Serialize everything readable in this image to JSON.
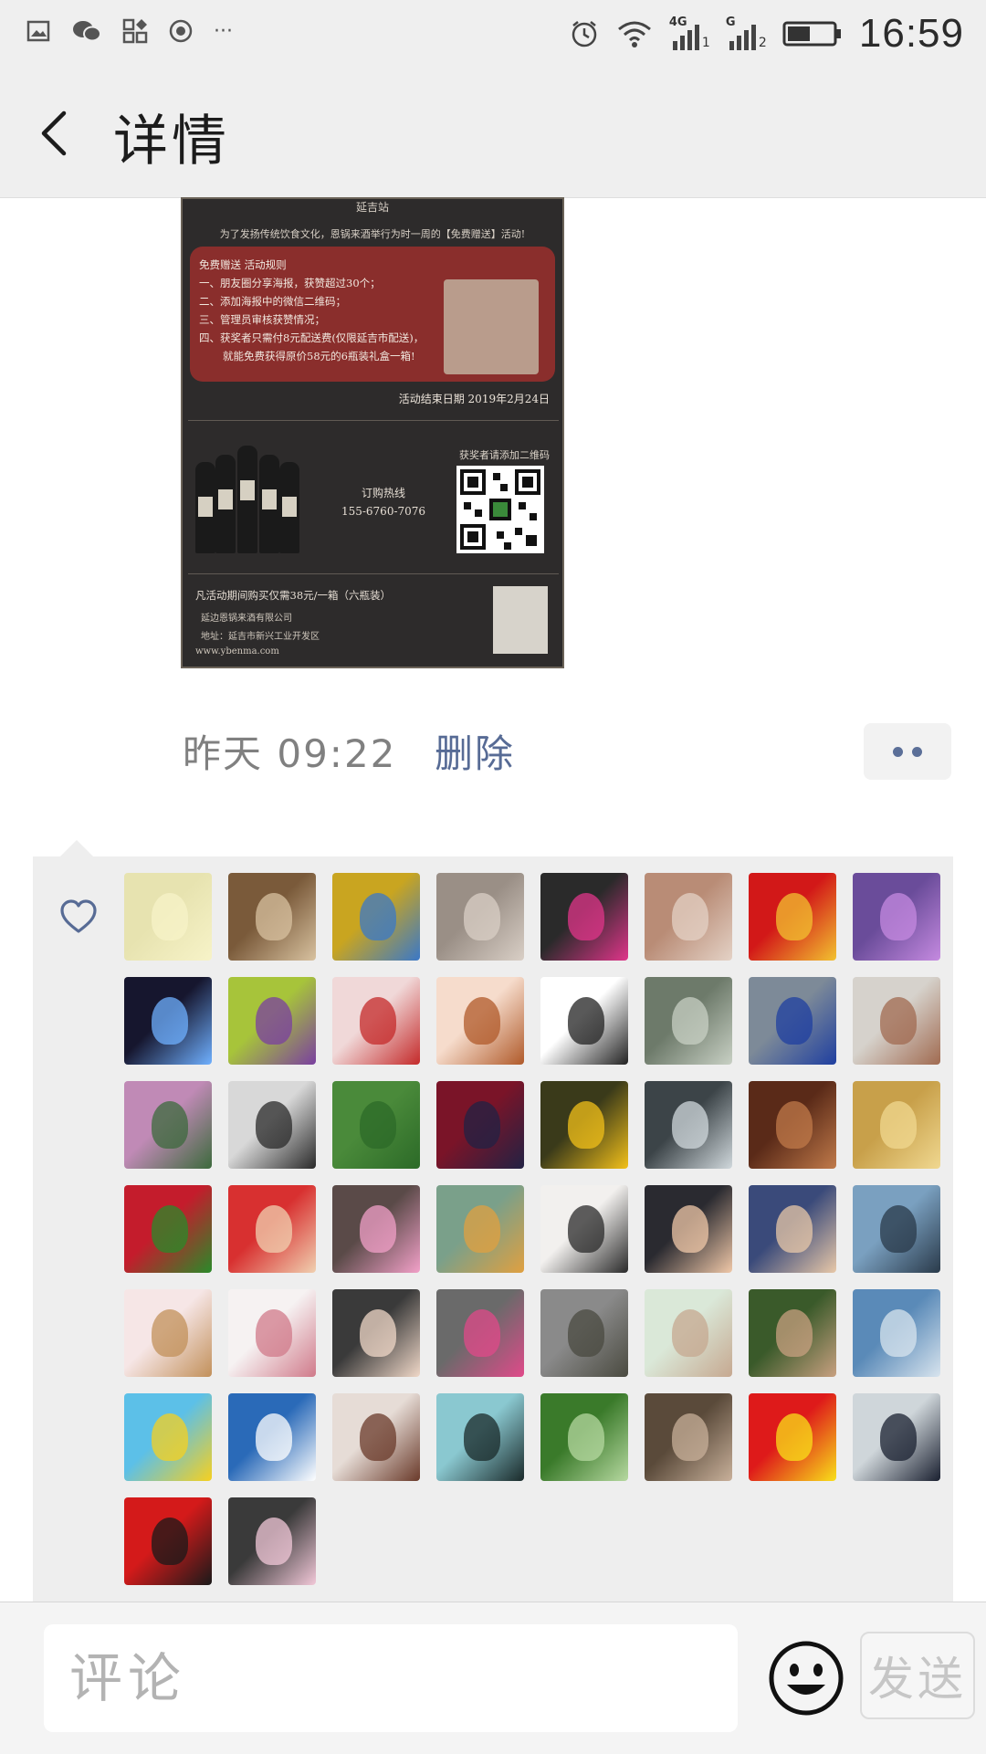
{
  "status_bar": {
    "time": "16:59",
    "network_1": "4G",
    "sim_1": "1",
    "network_2": "G",
    "sim_2": "2",
    "more": "···",
    "icons": [
      "gallery-icon",
      "wechat-icon",
      "apps-icon",
      "record-icon",
      "alarm-icon",
      "wifi-icon",
      "signal-icon",
      "battery-icon"
    ]
  },
  "nav": {
    "title": "详情",
    "back_icon": "chevron-left-icon"
  },
  "poster": {
    "station": "延吉站",
    "intro": "为了发扬传统饮食文化，恩锅来酒举行为时一周的【免费赠送】活动!",
    "rules_title": "免费赠送 活动规则",
    "rules": [
      "一、朋友圈分享海报，获赞超过30个；",
      "二、添加海报中的微信二维码；",
      "三、管理员审核获赞情况；",
      "四、获奖者只需付8元配送费(仅限延吉市配送)，",
      "就能免费获得原价58元的6瓶装礼盒一箱!"
    ],
    "end_date": "活动结束日期 2019年2月24日",
    "hotline_label": "订购热线",
    "hotline_number": "155-6760-7076",
    "qr_label": "获奖者请添加二维码",
    "buy_text": "凡活动期间购买仅需38元/一箱（六瓶装）",
    "company": "延边恩锅来酒有限公司",
    "address": "地址：延吉市新兴工业开发区",
    "website": "www.ybenma.com"
  },
  "post_meta": {
    "time": "昨天 09:22",
    "delete_label": "删除",
    "more_icon": "more-dots-icon"
  },
  "likes": {
    "heart_icon": "heart-outline-icon",
    "avatars": [
      {
        "color": "#e7e3b0",
        "accent": "#f7f3c8"
      },
      {
        "color": "#7a5a3a",
        "accent": "#d8c2a0"
      },
      {
        "color": "#c9a520",
        "accent": "#3a78c8"
      },
      {
        "color": "#9a8f86",
        "accent": "#d9cfc6"
      },
      {
        "color": "#2a2a2a",
        "accent": "#e0358a"
      },
      {
        "color": "#b98c76",
        "accent": "#e4d2c6"
      },
      {
        "color": "#d21818",
        "accent": "#f2c230"
      },
      {
        "color": "#6a4c9a",
        "accent": "#c58ae0"
      },
      {
        "color": "#16162e",
        "accent": "#6fb0ff"
      },
      {
        "color": "#a7c43a",
        "accent": "#7a3fa0"
      },
      {
        "color": "#f0d8d8",
        "accent": "#c42a2a"
      },
      {
        "color": "#f6dccc",
        "accent": "#b05a2a"
      },
      {
        "color": "#ffffff",
        "accent": "#222222"
      },
      {
        "color": "#6d7a6a",
        "accent": "#c8d0c4"
      },
      {
        "color": "#7d8a98",
        "accent": "#1f3fa0"
      },
      {
        "color": "#d6d2cc",
        "accent": "#a06a50"
      },
      {
        "color": "#c08ab6",
        "accent": "#3c6a3c"
      },
      {
        "color": "#d8d8d8",
        "accent": "#2a2a2a"
      },
      {
        "color": "#4a8a3a",
        "accent": "#2c6a28"
      },
      {
        "color": "#7a1428",
        "accent": "#222244"
      },
      {
        "color": "#3a3a1a",
        "accent": "#f2c01a"
      },
      {
        "color": "#3c4448",
        "accent": "#d0d8dc"
      },
      {
        "color": "#5a2a18",
        "accent": "#c07a4a"
      },
      {
        "color": "#c8a04a",
        "accent": "#f0d890"
      },
      {
        "color": "#c41c2c",
        "accent": "#2a8a2a"
      },
      {
        "color": "#d83030",
        "accent": "#f0d0b0"
      },
      {
        "color": "#5a4a48",
        "accent": "#f2a0c8"
      },
      {
        "color": "#7aa08a",
        "accent": "#e0a040"
      },
      {
        "color": "#f2f0ee",
        "accent": "#2a2a2a"
      },
      {
        "color": "#2a2a30",
        "accent": "#f0c8a8"
      },
      {
        "color": "#3a4a7a",
        "accent": "#e8c8a8"
      },
      {
        "color": "#7aa0c0",
        "accent": "#2a3a4a"
      },
      {
        "color": "#f6e6e6",
        "accent": "#c2905a"
      },
      {
        "color": "#f6f2f2",
        "accent": "#d07a8a"
      },
      {
        "color": "#3a3a3a",
        "accent": "#f0d8c8"
      },
      {
        "color": "#6a6a6a",
        "accent": "#e04a8a"
      },
      {
        "color": "#8a8a8a",
        "accent": "#4a4a40"
      },
      {
        "color": "#dae8d8",
        "accent": "#c6a890"
      },
      {
        "color": "#3a5a2a",
        "accent": "#c8a080"
      },
      {
        "color": "#5a8ab8",
        "accent": "#d8e4ee"
      },
      {
        "color": "#5cc0e8",
        "accent": "#f6d020"
      },
      {
        "color": "#2a6ab8",
        "accent": "#ffffff"
      },
      {
        "color": "#e6dcd6",
        "accent": "#6a3a2a"
      },
      {
        "color": "#8ac8d0",
        "accent": "#1a2a2a"
      },
      {
        "color": "#3a7a2a",
        "accent": "#b6d8a0"
      },
      {
        "color": "#5a4a3a",
        "accent": "#c8b09a"
      },
      {
        "color": "#de1a1a",
        "accent": "#f8e01a"
      },
      {
        "color": "#cfd6da",
        "accent": "#1a2030"
      },
      {
        "color": "#d41a1a",
        "accent": "#1a1a1a"
      },
      {
        "color": "#3a3a3a",
        "accent": "#f2c8d8"
      }
    ]
  },
  "comment_bar": {
    "placeholder": "评论",
    "emoji_icon": "smiley-face-icon",
    "send_label": "发送"
  }
}
